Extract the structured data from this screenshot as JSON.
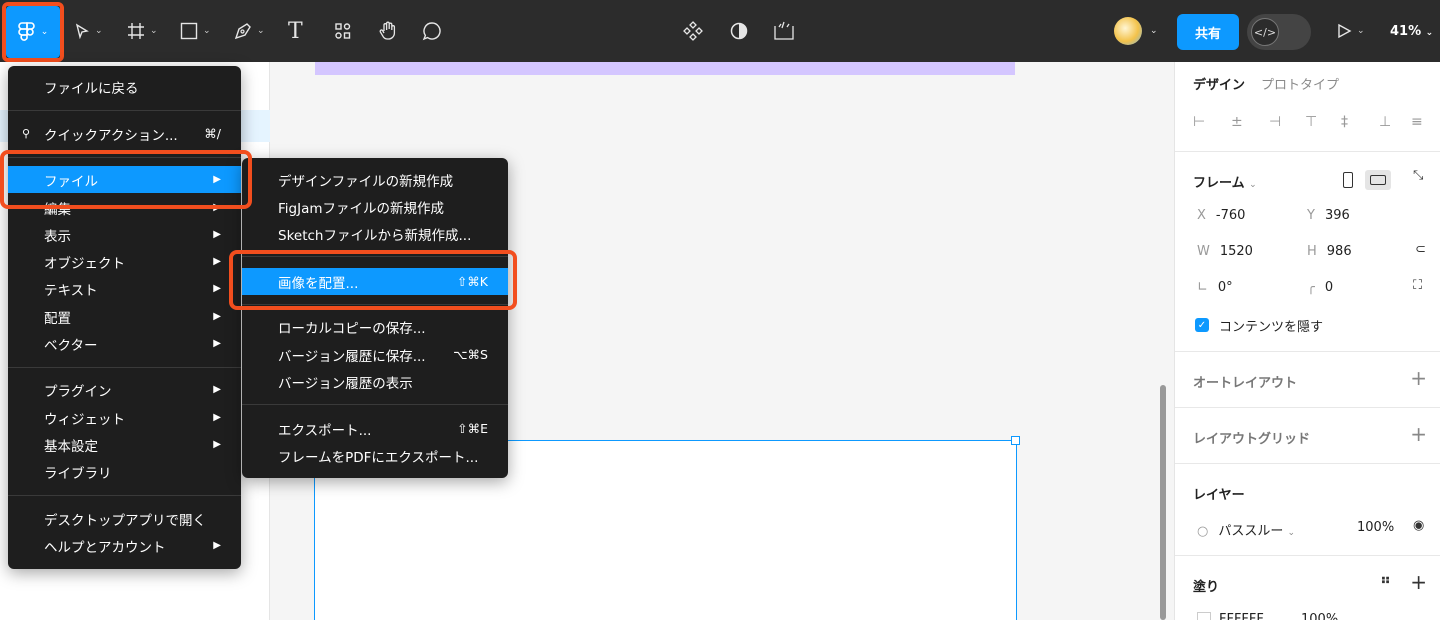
{
  "toolbar": {
    "main_menu_icon": "figma-logo-icon",
    "tools": [
      "move-tool",
      "frame-tool",
      "shape-tool",
      "pen-tool",
      "text-tool",
      "resources-tool",
      "hand-tool",
      "comment-tool"
    ],
    "text_tool_glyph": "T",
    "share_label": "共有",
    "devmode_glyph": "</>",
    "zoom": "41%"
  },
  "main_menu": {
    "items": [
      {
        "label": "ファイルに戻る"
      },
      {
        "label": "クイックアクション...",
        "shortcut": "⌘/"
      },
      {
        "label": "ファイル",
        "active": true
      },
      {
        "label": "編集"
      },
      {
        "label": "表示"
      },
      {
        "label": "オブジェクト"
      },
      {
        "label": "テキスト"
      },
      {
        "label": "配置"
      },
      {
        "label": "ベクター"
      },
      {
        "label": "プラグイン"
      },
      {
        "label": "ウィジェット"
      },
      {
        "label": "基本設定"
      },
      {
        "label": "ライブラリ"
      },
      {
        "label": "デスクトップアプリで開く"
      },
      {
        "label": "ヘルプとアカウント"
      }
    ]
  },
  "file_submenu": {
    "items": [
      {
        "label": "デザインファイルの新規作成"
      },
      {
        "label": "FigJamファイルの新規作成"
      },
      {
        "label": "Sketchファイルから新規作成..."
      },
      {
        "label": "画像を配置...",
        "shortcut": "⇧⌘K",
        "active": true
      },
      {
        "label": "ローカルコピーの保存..."
      },
      {
        "label": "バージョン履歴に保存...",
        "shortcut": "⌥⌘S"
      },
      {
        "label": "バージョン履歴の表示"
      },
      {
        "label": "エクスポート...",
        "shortcut": "⇧⌘E"
      },
      {
        "label": "フレームをPDFにエクスポート..."
      }
    ]
  },
  "right_panel": {
    "tabs": {
      "design": "デザイン",
      "prototype": "プロトタイプ"
    },
    "frame": {
      "title": "フレーム",
      "x_label": "X",
      "x": "-760",
      "y_label": "Y",
      "y": "396",
      "w_label": "W",
      "w": "1520",
      "h_label": "H",
      "h": "986",
      "rotation": "0°",
      "radius": "0",
      "clip_content": "コンテンツを隠す"
    },
    "auto_layout": "オートレイアウト",
    "layout_grid": "レイアウトグリッド",
    "layer": {
      "title": "レイヤー",
      "blend": "パススルー",
      "opacity": "100%"
    },
    "fill": {
      "title": "塗り",
      "hex": "FFFFFF",
      "opacity": "100%"
    }
  },
  "colors": {
    "accent": "#0d99ff",
    "highlight": "#f24e1e",
    "menu_bg": "#1e1e1e",
    "toolbar_bg": "#2c2c2c",
    "frame_purple": "#d4c6ff"
  }
}
